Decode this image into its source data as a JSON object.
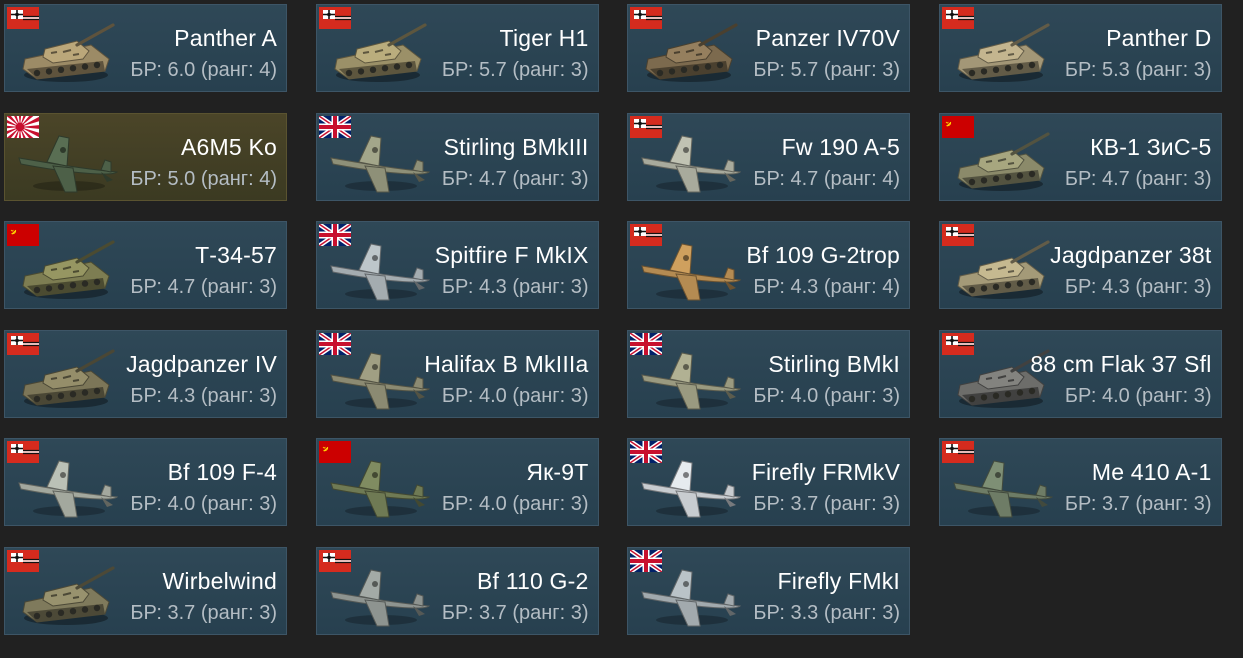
{
  "cards": [
    {
      "name": "Panther A",
      "br": "БР: 6.0 (ранг: 4)",
      "flag": "germany",
      "kind": "tank",
      "color": "#9c8b66",
      "premium": false
    },
    {
      "name": "Tiger H1",
      "br": "БР: 5.7 (ранг: 3)",
      "flag": "germany",
      "kind": "tank",
      "color": "#9b9068",
      "premium": false
    },
    {
      "name": "Panzer IV70V",
      "br": "БР: 5.7 (ранг: 3)",
      "flag": "germany",
      "kind": "tank",
      "color": "#7c6a4e",
      "premium": false
    },
    {
      "name": "Panther D",
      "br": "БР: 5.3 (ранг: 3)",
      "flag": "germany",
      "kind": "tank",
      "color": "#a39777",
      "premium": false
    },
    {
      "name": "A6M5 Ko",
      "br": "БР: 5.0 (ранг: 4)",
      "flag": "japan",
      "kind": "plane",
      "color": "#4d6048",
      "premium": true
    },
    {
      "name": "Stirling BMkIII",
      "br": "БР: 4.7 (ранг: 3)",
      "flag": "uk",
      "kind": "plane",
      "color": "#8e9078",
      "premium": false
    },
    {
      "name": "Fw 190 A-5",
      "br": "БР: 4.7 (ранг: 4)",
      "flag": "germany",
      "kind": "plane",
      "color": "#a8aa9c",
      "premium": false
    },
    {
      "name": "КВ-1 ЗиС-5",
      "br": "БР: 4.7 (ранг: 3)",
      "flag": "ussr",
      "kind": "tank",
      "color": "#8b8a6a",
      "premium": false
    },
    {
      "name": "Т-34-57",
      "br": "БР: 4.7 (ранг: 3)",
      "flag": "ussr",
      "kind": "tank",
      "color": "#7d7d52",
      "premium": false
    },
    {
      "name": "Spitfire F MkIX",
      "br": "БР: 4.3 (ранг: 3)",
      "flag": "uk",
      "kind": "plane",
      "color": "#a4acb0",
      "premium": false
    },
    {
      "name": "Bf 109 G-2trop",
      "br": "БР: 4.3 (ранг: 4)",
      "flag": "germany",
      "kind": "plane",
      "color": "#b48b52",
      "premium": false
    },
    {
      "name": "Jagdpanzer 38t",
      "br": "БР: 4.3 (ранг: 3)",
      "flag": "germany",
      "kind": "tank",
      "color": "#a49a78",
      "premium": false
    },
    {
      "name": "Jagdpanzer IV",
      "br": "БР: 4.3 (ранг: 3)",
      "flag": "germany",
      "kind": "tank",
      "color": "#7c7658",
      "premium": false
    },
    {
      "name": "Halifax B MkIIIa",
      "br": "БР: 4.0 (ранг: 3)",
      "flag": "uk",
      "kind": "plane",
      "color": "#8b8a72",
      "premium": false
    },
    {
      "name": "Stirling BMkI",
      "br": "БР: 4.0 (ранг: 3)",
      "flag": "uk",
      "kind": "plane",
      "color": "#9a9a80",
      "premium": false
    },
    {
      "name": "88 cm Flak 37 Sfl",
      "br": "БР: 4.0 (ранг: 3)",
      "flag": "germany",
      "kind": "tank",
      "color": "#6d6d6a",
      "premium": false
    },
    {
      "name": "Bf 109 F-4",
      "br": "БР: 4.0 (ранг: 3)",
      "flag": "germany",
      "kind": "plane",
      "color": "#a3a89e",
      "premium": false
    },
    {
      "name": "Як-9Т",
      "br": "БР: 4.0 (ранг: 3)",
      "flag": "ussr",
      "kind": "plane",
      "color": "#6f7a54",
      "premium": false
    },
    {
      "name": "Firefly FRMkV",
      "br": "БР: 3.7 (ранг: 3)",
      "flag": "uk",
      "kind": "plane",
      "color": "#c8ccd0",
      "premium": false
    },
    {
      "name": "Me 410 A-1",
      "br": "БР: 3.7 (ранг: 3)",
      "flag": "germany",
      "kind": "plane",
      "color": "#6e7c66",
      "premium": false
    },
    {
      "name": "Wirbelwind",
      "br": "БР: 3.7 (ранг: 3)",
      "flag": "germany",
      "kind": "tank",
      "color": "#7f7a5c",
      "premium": false
    },
    {
      "name": "Bf 110 G-2",
      "br": "БР: 3.7 (ранг: 3)",
      "flag": "germany",
      "kind": "plane",
      "color": "#8e9490",
      "premium": false
    },
    {
      "name": "Firefly FMkI",
      "br": "БР: 3.3 (ранг: 3)",
      "flag": "uk",
      "kind": "plane",
      "color": "#a2aaae",
      "premium": false
    }
  ]
}
